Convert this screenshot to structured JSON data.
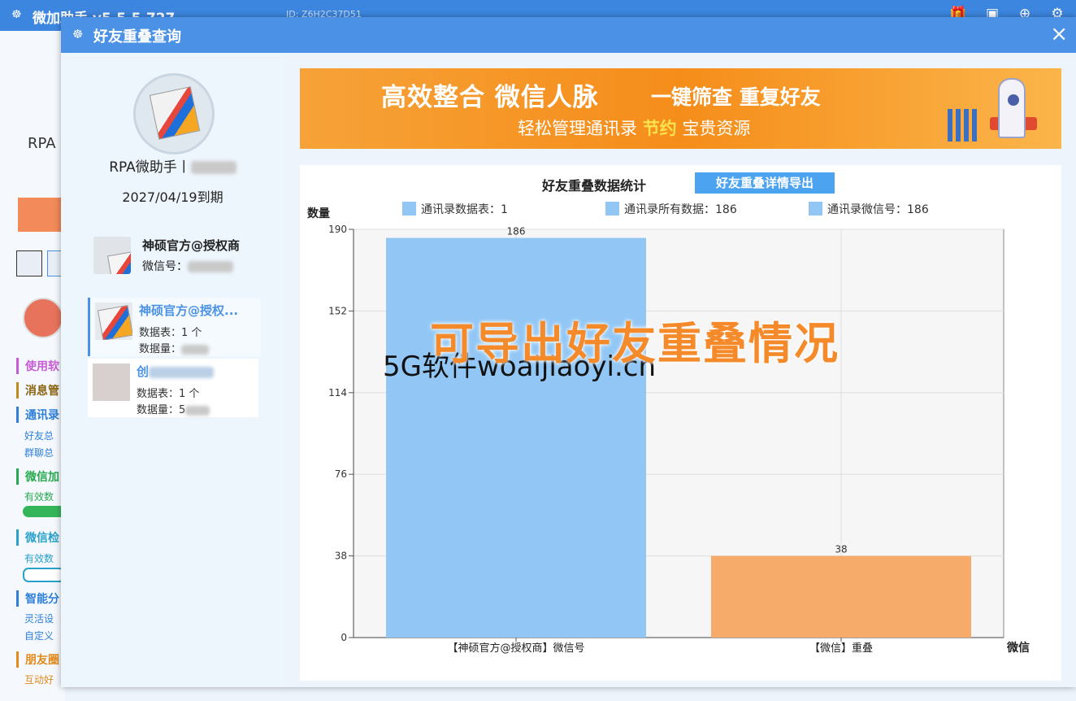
{
  "app": {
    "title": "微加助手 v5.5.5.727",
    "id_text": "ID: Z6H2C37D51",
    "rpa_label": "RPA",
    "menu": [
      {
        "label": "使用软",
        "color": "#c85bd6"
      },
      {
        "label": "消息管",
        "color": "#c08a1a"
      },
      {
        "label": "通讯录",
        "color": "#2d7fd9",
        "subs": [
          "好友总",
          "群聊总"
        ]
      },
      {
        "label": "微信加",
        "color": "#27a94e",
        "subs": [
          "有效数"
        ]
      },
      {
        "label": "微信检",
        "color": "#2aa1c9",
        "subs": [
          "有效数"
        ]
      },
      {
        "label": "智能分",
        "color": "#2d7fd9",
        "subs": [
          "灵活设",
          "自定义"
        ]
      },
      {
        "label": "朋友圈",
        "color": "#e28a1a",
        "subs": [
          "互动好"
        ]
      }
    ]
  },
  "dialog": {
    "title": "好友重叠查询",
    "close_icon": "×",
    "account": {
      "name": "RPA微助手丨",
      "expiry": "2027/04/19到期"
    },
    "auth": {
      "name": "神硕官方@授权商",
      "wechat_label": "微信号："
    },
    "items": [
      {
        "name": "神硕官方@授权...",
        "tables": "数据表：1 个",
        "count": "数据量："
      },
      {
        "name": "创",
        "tables": "数据表：1 个",
        "count": "数据量：5"
      }
    ],
    "ad": {
      "line1": "高效整合 微信人脉",
      "line1b": "一键筛查 重复好友",
      "line2_a": "轻松管理通讯录",
      "line2_hl": "节约",
      "line2_b": "宝贵资源"
    },
    "stats": {
      "title": "好友重叠数据统计",
      "export_button": "好友重叠详情导出",
      "legend": [
        "通讯录数据表：1",
        "通讯录所有数据：186",
        "通讯录微信号：186"
      ],
      "watermark_orange": "可导出好友重叠情况",
      "watermark_black": "5G软件woaijiaoyi.cn"
    }
  },
  "chart_data": {
    "type": "bar",
    "ylabel": "数量",
    "xlabel": "微信",
    "ylim": [
      0,
      190
    ],
    "yticks": [
      0,
      38,
      76,
      114,
      152,
      190
    ],
    "categories": [
      "【神硕官方@授权商】微信号",
      "【微信】重叠"
    ],
    "values": [
      186,
      38
    ],
    "colors": [
      "#92c7f5",
      "#f7ab6a"
    ],
    "grid": true
  }
}
